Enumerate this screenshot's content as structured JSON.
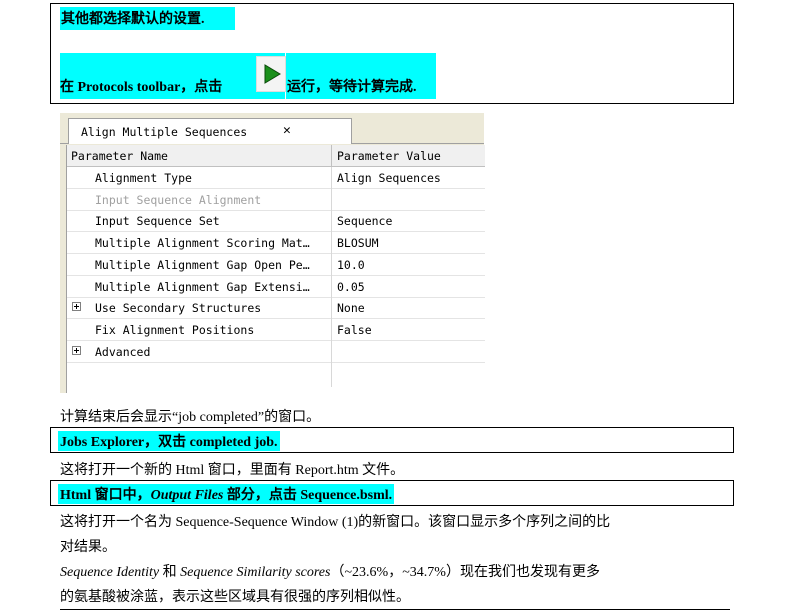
{
  "top_box": {
    "line1": "其他都选择默认的设置.",
    "line2_before": "在  Protocols toolbar，点击",
    "line2_after": "运行，等待计算完成.",
    "run_icon": "play-arrow-icon"
  },
  "dialog": {
    "tab_title": "Align Multiple Sequences",
    "columns": [
      "Parameter Name",
      "Parameter Value"
    ],
    "rows": [
      {
        "name": "Alignment Type",
        "value": "Align Sequences",
        "expandable": false,
        "disabled": false
      },
      {
        "name": "Input Sequence Alignment",
        "value": "",
        "expandable": false,
        "disabled": true
      },
      {
        "name": "Input Sequence Set",
        "value": "Sequence",
        "expandable": false,
        "disabled": false
      },
      {
        "name": "Multiple Alignment Scoring Mat…",
        "value": "BLOSUM",
        "expandable": false,
        "disabled": false
      },
      {
        "name": "Multiple Alignment Gap Open Pe…",
        "value": "10.0",
        "expandable": false,
        "disabled": false
      },
      {
        "name": "Multiple Alignment Gap Extensi…",
        "value": "0.05",
        "expandable": false,
        "disabled": false
      },
      {
        "name": "Use Secondary Structures",
        "value": "None",
        "expandable": true,
        "disabled": false
      },
      {
        "name": "Fix Alignment Positions",
        "value": "False",
        "expandable": false,
        "disabled": false
      },
      {
        "name": "Advanced",
        "value": "",
        "expandable": true,
        "disabled": false
      }
    ]
  },
  "text": {
    "p1": "计算结束后会显示“job completed”的窗口。",
    "box2": "Jobs Explorer，双击 completed job.",
    "p2": "这将打开一个新的 Html 窗口，里面有 Report.htm 文件。",
    "box3_a": "Html  窗口中，",
    "box3_b": "Output Files",
    "box3_c": " 部分，点击  Sequence.bsml.",
    "p3_line1": "这将打开一个名为 Sequence-Sequence Window (1)的新窗口。该窗口显示多个序列之间的比",
    "p3_line2": "对结果。",
    "p4_a": "Sequence Identity",
    "p4_b": " 和 ",
    "p4_c": "Sequence Similarity scores",
    "p4_d": "（~23.6%，~34.7%）现在我们也发现有更多",
    "p4_line2": "的氨基酸被涂蓝，表示这些区域具有很强的序列相似性。"
  },
  "colors": {
    "highlight": "#00ffff",
    "run_arrow": "#1a8f1a"
  }
}
